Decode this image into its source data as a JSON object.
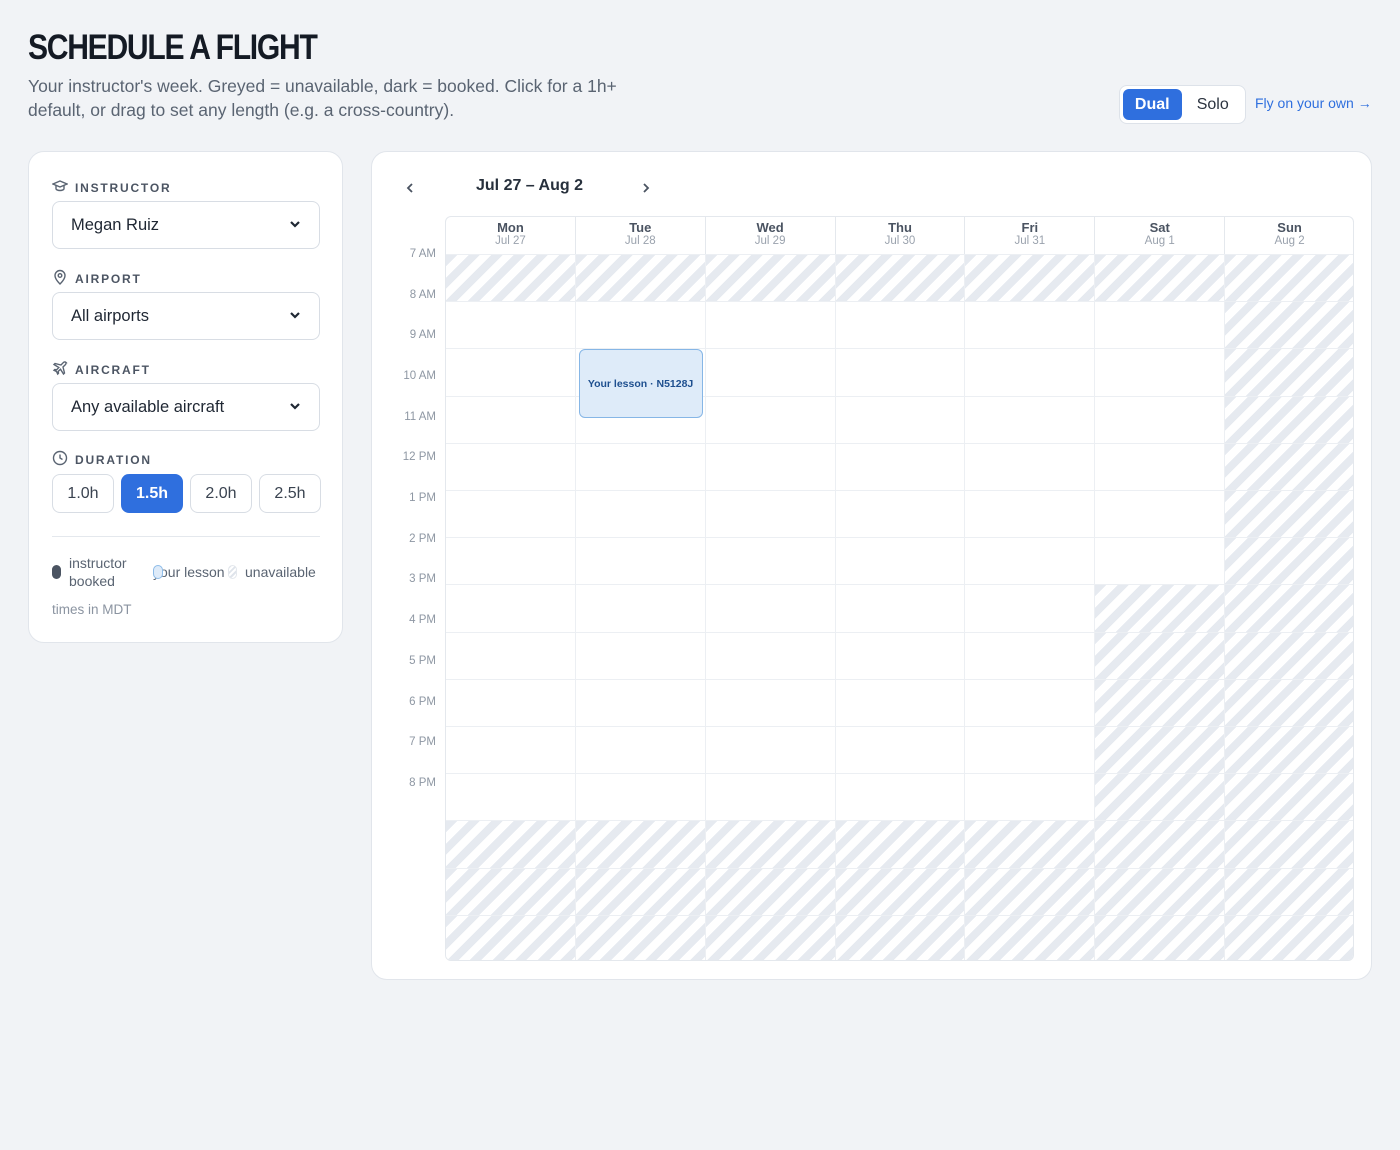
{
  "header": {
    "title": "SCHEDULE A FLIGHT",
    "subtitle": "Your instructor's week. Greyed = unavailable, dark = booked. Click for a 1h+ default, or drag to set any length (e.g. a cross-country).",
    "mode_toggle": {
      "options": [
        "Dual",
        "Solo"
      ],
      "selected": "Dual"
    },
    "solo_link": "Fly on your own →"
  },
  "sidebar": {
    "instructor": {
      "label": "INSTRUCTOR",
      "value": "Megan Ruiz",
      "icon": "graduation-cap-icon"
    },
    "airport": {
      "label": "AIRPORT",
      "value": "All airports",
      "icon": "map-pin-icon"
    },
    "aircraft": {
      "label": "AIRCRAFT",
      "value": "Any available aircraft",
      "icon": "plane-icon"
    },
    "duration": {
      "label": "DURATION",
      "icon": "clock-icon",
      "options": [
        "1.0h",
        "1.5h",
        "2.0h",
        "2.5h"
      ],
      "selected": "1.5h"
    },
    "legend": {
      "booked": "instructor booked",
      "lesson": "your lesson",
      "unavailable": "unavailable"
    },
    "timezone_note": "times in MDT"
  },
  "calendar": {
    "week_range": "Jul 27 – Aug 2",
    "days": [
      {
        "name": "Mon",
        "date": "Jul 27"
      },
      {
        "name": "Tue",
        "date": "Jul 28"
      },
      {
        "name": "Wed",
        "date": "Jul 29"
      },
      {
        "name": "Thu",
        "date": "Jul 30"
      },
      {
        "name": "Fri",
        "date": "Jul 31"
      },
      {
        "name": "Sat",
        "date": "Aug 1"
      },
      {
        "name": "Sun",
        "date": "Aug 2"
      }
    ],
    "hours": [
      "7 AM",
      "8 AM",
      "9 AM",
      "10 AM",
      "11 AM",
      "12 PM",
      "1 PM",
      "2 PM",
      "3 PM",
      "4 PM",
      "5 PM",
      "6 PM",
      "7 PM",
      "8 PM"
    ],
    "availability": [
      [
        0,
        1,
        1,
        1,
        1,
        1,
        1,
        1,
        1,
        1,
        1,
        1,
        0,
        0
      ],
      [
        0,
        1,
        1,
        1,
        1,
        1,
        1,
        1,
        1,
        1,
        1,
        1,
        0,
        0
      ],
      [
        0,
        1,
        1,
        1,
        1,
        1,
        1,
        1,
        1,
        1,
        1,
        1,
        0,
        0
      ],
      [
        0,
        1,
        1,
        1,
        1,
        1,
        1,
        1,
        1,
        1,
        1,
        1,
        0,
        0
      ],
      [
        0,
        1,
        1,
        1,
        1,
        1,
        1,
        1,
        1,
        1,
        1,
        1,
        0,
        0
      ],
      [
        0,
        1,
        1,
        1,
        1,
        1,
        1,
        0,
        0,
        0,
        0,
        0,
        0,
        0
      ],
      [
        0,
        0,
        0,
        0,
        0,
        0,
        0,
        0,
        0,
        0,
        0,
        0,
        0,
        0
      ]
    ],
    "lesson": {
      "label": "Your lesson · N5128J",
      "day": "Tue",
      "start": "9 AM",
      "duration": "1.5h"
    },
    "colors": {
      "accent": "#2f6fde",
      "lesson_fill": "#deebf9",
      "booked": "#4b5462",
      "unavailable_stripe": "#e6eaf0"
    }
  }
}
